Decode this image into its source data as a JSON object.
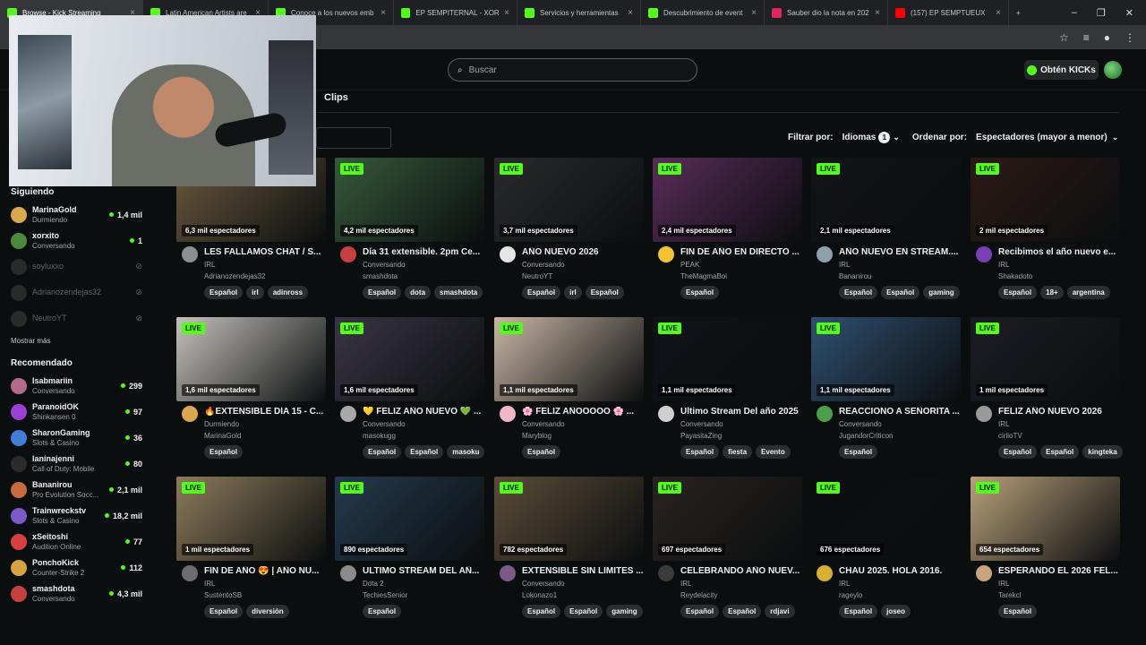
{
  "browser": {
    "tabs": [
      {
        "title": "Browse - Kick Streaming",
        "color": "#53fc18",
        "active": true
      },
      {
        "title": "Latin American Artists are",
        "color": "#53fc18"
      },
      {
        "title": "Conoce a los nuevos emb",
        "color": "#53fc18"
      },
      {
        "title": "EP SEMPITERNAL - XORX",
        "color": "#53fc18"
      },
      {
        "title": "Servicios y herramientas",
        "color": "#53fc18"
      },
      {
        "title": "Descubrimiento de event",
        "color": "#53fc18"
      },
      {
        "title": "Sauber dio la nota en 202",
        "color": "#e0245e"
      },
      {
        "title": "(157) EP SEMPTUEUX",
        "color": "#ff0000"
      }
    ],
    "new_tab": "+",
    "window_controls": [
      "–",
      "❐",
      "✕"
    ]
  },
  "header": {
    "search_placeholder": "Buscar",
    "get_kicks": "Obtén KICKs"
  },
  "tabs": {
    "clips": "Clips"
  },
  "filters": {
    "filter_label": "Filtrar por:",
    "languages": "Idiomas",
    "languages_count": "1",
    "sort_label": "Ordenar por:",
    "sort_value": "Espectadores (mayor a menor)"
  },
  "sidebar": {
    "following_title": "Siguiendo",
    "following": [
      {
        "name": "MarinaGold",
        "sub": "Durmiendo",
        "viewers": "1,4 mil",
        "color": "#d9a84e"
      },
      {
        "name": "xorxito",
        "sub": "Conversando",
        "viewers": "1",
        "color": "#4b8a3c"
      },
      {
        "name": "soyluxxo",
        "offline": true,
        "color": "#666"
      },
      {
        "name": "Adrianozendejas32",
        "offline": true,
        "color": "#666"
      },
      {
        "name": "NeutroYT",
        "offline": true,
        "color": "#666"
      }
    ],
    "show_more": "Mostrar más",
    "recommended_title": "Recomendado",
    "recommended": [
      {
        "name": "Isabmariin",
        "sub": "Conversando",
        "viewers": "299",
        "color": "#b46a8c"
      },
      {
        "name": "ParanoidOK",
        "sub": "Shinkansen 0",
        "viewers": "97",
        "color": "#9c3fd8"
      },
      {
        "name": "SharonGaming",
        "sub": "Slots & Casino",
        "viewers": "36",
        "color": "#3f7fd8"
      },
      {
        "name": "laninajenni",
        "sub": "Call of Duty: Mobile",
        "viewers": "80",
        "color": "#2b2b2b"
      },
      {
        "name": "Bananirou",
        "sub": "Pro Evolution Socc...",
        "viewers": "2,1 mil",
        "color": "#c86a3d"
      },
      {
        "name": "Trainwreckstv",
        "sub": "Slots & Casino",
        "viewers": "18,2 mil",
        "color": "#7a5ac8"
      },
      {
        "name": "xSeitoshi",
        "sub": "Audition Online",
        "viewers": "77",
        "color": "#d84040"
      },
      {
        "name": "PonchoKick",
        "sub": "Counter-Strike 2",
        "viewers": "112",
        "color": "#d8a33f"
      },
      {
        "name": "smashdota",
        "sub": "Conversando",
        "viewers": "4,3 mil",
        "color": "#c83f3f"
      }
    ]
  },
  "streams": [
    {
      "title": "LES FALLAMOS CHAT / S...",
      "category": "IRL",
      "user": "Adrianozendejas32",
      "viewers": "6,3 mil espectadores",
      "tags": [
        "Español",
        "irl",
        "adinross"
      ],
      "thumb": "#6b5a3e",
      "avatar": "#8a8f94"
    },
    {
      "title": "Día 31 extensible. 2pm Ce...",
      "category": "Conversando",
      "user": "smashdota",
      "viewers": "4,2 mil espectadores",
      "tags": [
        "Español",
        "dota",
        "smashdota"
      ],
      "thumb": "#355a3a",
      "avatar": "#c83f3f"
    },
    {
      "title": "AÑO NUEVO 2026",
      "category": "Conversando",
      "user": "NeutroYT",
      "viewers": "3,7 mil espectadores",
      "tags": [
        "Español",
        "irl",
        "Español"
      ],
      "thumb": "#2a2a2c",
      "avatar": "#e6e6e6"
    },
    {
      "title": "FIN DE AÑO EN DIRECTO ...",
      "category": "PEAK",
      "user": "TheMagmaBoi",
      "viewers": "2,4 mil espectadores",
      "tags": [
        "Español"
      ],
      "thumb": "#5a2b5a",
      "avatar": "#f2c230"
    },
    {
      "title": "AÑO NUEVO EN STREAM....",
      "category": "IRL",
      "user": "Bananirou",
      "viewers": "2,1 mil espectadores",
      "tags": [
        "Español",
        "Español",
        "gaming"
      ],
      "thumb": "#121418",
      "avatar": "#8fa0ad"
    },
    {
      "title": "Recibimos el año nuevo e...",
      "category": "IRL",
      "user": "Shakadoto",
      "viewers": "2 mil espectadores",
      "tags": [
        "Español",
        "18+",
        "argentina"
      ],
      "thumb": "#2b1a16",
      "avatar": "#7a3fb4"
    },
    {
      "title": "🔥EXTENSIBLE DÍA 15 - C...",
      "category": "Durmiendo",
      "user": "MarinaGold",
      "viewers": "1,6 mil espectadores",
      "tags": [
        "Español"
      ],
      "thumb": "#c6c2bd",
      "avatar": "#d9a84e"
    },
    {
      "title": "💛 FELIZ AÑO NUEVO 💚 ...",
      "category": "Conversando",
      "user": "masokugg",
      "viewers": "1,6 mil espectadores",
      "tags": [
        "Español",
        "Español",
        "masoku"
      ],
      "thumb": "#3a3545",
      "avatar": "#a8a8a8"
    },
    {
      "title": "🌸 FELIZ AÑOOOOO 🌸 ...",
      "category": "Conversando",
      "user": "Maryblog",
      "viewers": "1,1 mil espectadores",
      "tags": [
        "Español"
      ],
      "thumb": "#c9b6a5",
      "avatar": "#f2b6c6"
    },
    {
      "title": "Ultimo Stream Del año 2025",
      "category": "Conversando",
      "user": "PayasitaZing",
      "viewers": "1,1 mil espectadores",
      "tags": [
        "Español",
        "fiesta",
        "Evento"
      ],
      "thumb": "#101318",
      "avatar": "#cfcfcf"
    },
    {
      "title": "REACCIONO A SEÑORITA ...",
      "category": "Conversando",
      "user": "JugandorCriticon",
      "viewers": "1,1 mil espectadores",
      "tags": [
        "Español"
      ],
      "thumb": "#2f4f6f",
      "avatar": "#4aa04a"
    },
    {
      "title": "FELIZ AÑO NUEVO 2026",
      "category": "IRL",
      "user": "cirlioTV",
      "viewers": "1 mil espectadores",
      "tags": [
        "Español",
        "Español",
        "kingteka"
      ],
      "thumb": "#1b1d24",
      "avatar": "#9a9a9a"
    },
    {
      "title": "FIN DE AÑO 😍 | AÑO NU...",
      "category": "IRL",
      "user": "SustentoSB",
      "viewers": "1 mil espectadores",
      "tags": [
        "Español",
        "diversión"
      ],
      "thumb": "#8c7b5a",
      "avatar": "#6d6d6d"
    },
    {
      "title": "ULTIMO STREAM DEL AÑ...",
      "category": "Dota 2",
      "user": "TechiesSenior",
      "viewers": "890 espectadores",
      "tags": [
        "Español"
      ],
      "thumb": "#243a4e",
      "avatar": "#8a8a8a"
    },
    {
      "title": "EXTENSIBLE SIN LIMITES ...",
      "category": "Conversando",
      "user": "Lokonazo1",
      "viewers": "782 espectadores",
      "tags": [
        "Español",
        "Español",
        "gaming"
      ],
      "thumb": "#5a4c38",
      "avatar": "#7b5a8a"
    },
    {
      "title": "CELEBRANDO AÑO NUEV...",
      "category": "IRL",
      "user": "Reydelacity",
      "viewers": "697 espectadores",
      "tags": [
        "Español",
        "Español",
        "rdjavi"
      ],
      "thumb": "#2a2320",
      "avatar": "#3a3a3a"
    },
    {
      "title": "CHAU 2025. HOLA 2016.",
      "category": "IRL",
      "user": "rageylo",
      "viewers": "676 espectadores",
      "tags": [
        "Español",
        "joseo"
      ],
      "thumb": "#0c0d10",
      "avatar": "#d8b030"
    },
    {
      "title": "ESPERANDO EL 2026 FEL...",
      "category": "IRL",
      "user": "Tarekcl",
      "viewers": "654 espectadores",
      "tags": [
        "Español"
      ],
      "thumb": "#b9a07a",
      "avatar": "#c8a57a"
    }
  ],
  "live_label": "LIVE"
}
